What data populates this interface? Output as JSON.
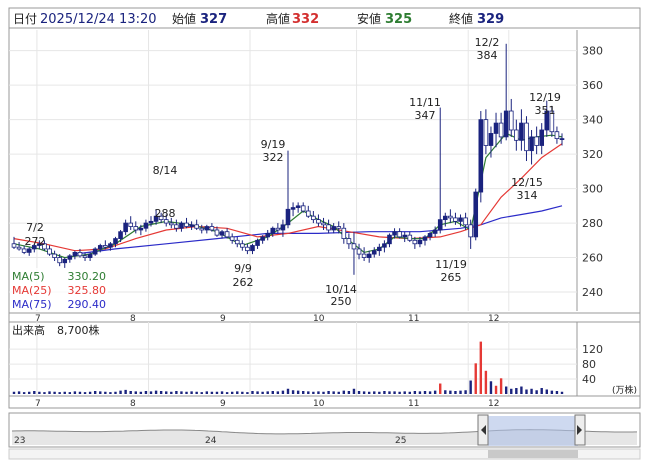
{
  "header": {
    "date_label": "日付",
    "datetime": "2025/12/24 13:20",
    "open_label": "始値",
    "open_value": "327",
    "high_label": "高値",
    "high_value": "332",
    "low_label": "安値",
    "low_value": "325",
    "close_label": "終値",
    "close_value": "329"
  },
  "legend": {
    "ma5": "MA(5)",
    "ma5_value": "330.20",
    "ma25": "MA(25)",
    "ma25_value": "325.80",
    "ma75": "MA(75)",
    "ma75_value": "290.40"
  },
  "volume_panel": {
    "title": "出来高",
    "value": "8,700株",
    "unit": "(万株)"
  },
  "navigator": {
    "date_labels": [
      "23",
      "24",
      "25"
    ]
  },
  "colors": {
    "up": "#1a237e",
    "down": "#ffffff",
    "ma5": "#2e7d32",
    "ma25": "#e53935",
    "ma75": "#2b2bc8",
    "volume": "#1a237e",
    "volume_spike": "#e53935",
    "navigator_fill": "#aebfe6",
    "header_value": "#1a237e",
    "high_value": "#d32f2f",
    "low_value": "#2e7d32"
  },
  "chart_data": {
    "type": "candlestick",
    "frequency": "daily",
    "x_month_labels": [
      "7",
      "8",
      "9",
      "10",
      "11",
      "12"
    ],
    "y_ticks": [
      240,
      260,
      280,
      300,
      320,
      340,
      360,
      380
    ],
    "ylim": [
      229,
      392
    ],
    "volume_ticks": [
      40,
      80,
      120
    ],
    "annotations": [
      {
        "date": "7/2",
        "value": "272",
        "kind": "high"
      },
      {
        "date": "8/14",
        "value": "288",
        "kind": "high"
      },
      {
        "date": "9/19",
        "value": "322",
        "kind": "high"
      },
      {
        "date": "9/9",
        "value": "262",
        "kind": "low"
      },
      {
        "date": "10/14",
        "value": "250",
        "kind": "low"
      },
      {
        "date": "11/11",
        "value": "347",
        "kind": "high"
      },
      {
        "date": "11/19",
        "value": "265",
        "kind": "low"
      },
      {
        "date": "12/2",
        "value": "384",
        "kind": "high"
      },
      {
        "date": "12/19",
        "value": "351",
        "kind": "high"
      },
      {
        "date": "12/15",
        "value": "314",
        "kind": "low"
      }
    ],
    "ohlc": [
      [
        268,
        272,
        265,
        266
      ],
      [
        266,
        269,
        264,
        265
      ],
      [
        265,
        267,
        262,
        263
      ],
      [
        263,
        266,
        261,
        265
      ],
      [
        265,
        268,
        263,
        267
      ],
      [
        267,
        270,
        265,
        268
      ],
      [
        268,
        270,
        264,
        265
      ],
      [
        265,
        267,
        261,
        262
      ],
      [
        262,
        264,
        258,
        260
      ],
      [
        260,
        262,
        255,
        257
      ],
      [
        257,
        260,
        254,
        259
      ],
      [
        259,
        262,
        257,
        261
      ],
      [
        261,
        264,
        259,
        263
      ],
      [
        263,
        265,
        260,
        261
      ],
      [
        261,
        263,
        258,
        260
      ],
      [
        260,
        263,
        258,
        262
      ],
      [
        262,
        266,
        261,
        265
      ],
      [
        265,
        268,
        263,
        267
      ],
      [
        267,
        270,
        265,
        266
      ],
      [
        266,
        269,
        264,
        268
      ],
      [
        268,
        272,
        266,
        271
      ],
      [
        271,
        276,
        269,
        275
      ],
      [
        275,
        282,
        273,
        280
      ],
      [
        280,
        284,
        276,
        278
      ],
      [
        278,
        281,
        274,
        276
      ],
      [
        276,
        279,
        273,
        277
      ],
      [
        277,
        282,
        275,
        280
      ],
      [
        280,
        284,
        278,
        281
      ],
      [
        281,
        288,
        279,
        284
      ],
      [
        284,
        286,
        280,
        282
      ],
      [
        282,
        285,
        278,
        280
      ],
      [
        280,
        283,
        277,
        279
      ],
      [
        279,
        282,
        275,
        277
      ],
      [
        277,
        281,
        275,
        280
      ],
      [
        280,
        283,
        277,
        278
      ],
      [
        278,
        281,
        276,
        279
      ],
      [
        279,
        282,
        276,
        277
      ],
      [
        277,
        279,
        274,
        276
      ],
      [
        276,
        279,
        274,
        278
      ],
      [
        278,
        280,
        275,
        276
      ],
      [
        276,
        278,
        272,
        273
      ],
      [
        273,
        276,
        271,
        275
      ],
      [
        275,
        277,
        271,
        272
      ],
      [
        272,
        274,
        268,
        270
      ],
      [
        270,
        272,
        266,
        268
      ],
      [
        268,
        270,
        264,
        266
      ],
      [
        266,
        268,
        262,
        264
      ],
      [
        264,
        268,
        262,
        267
      ],
      [
        267,
        271,
        265,
        270
      ],
      [
        270,
        273,
        268,
        272
      ],
      [
        272,
        276,
        270,
        274
      ],
      [
        274,
        278,
        272,
        277
      ],
      [
        277,
        280,
        274,
        276
      ],
      [
        276,
        282,
        272,
        279
      ],
      [
        279,
        322,
        277,
        288
      ],
      [
        288,
        292,
        284,
        289
      ],
      [
        289,
        292,
        286,
        290
      ],
      [
        290,
        292,
        286,
        287
      ],
      [
        287,
        290,
        283,
        284
      ],
      [
        284,
        287,
        280,
        282
      ],
      [
        282,
        285,
        278,
        280
      ],
      [
        280,
        283,
        276,
        279
      ],
      [
        279,
        282,
        274,
        276
      ],
      [
        276,
        280,
        274,
        278
      ],
      [
        278,
        281,
        274,
        277
      ],
      [
        277,
        280,
        268,
        271
      ],
      [
        271,
        274,
        265,
        268
      ],
      [
        268,
        275,
        250,
        265
      ],
      [
        265,
        268,
        259,
        262
      ],
      [
        262,
        266,
        258,
        260
      ],
      [
        260,
        264,
        257,
        262
      ],
      [
        262,
        266,
        260,
        264
      ],
      [
        264,
        268,
        261,
        266
      ],
      [
        266,
        270,
        263,
        268
      ],
      [
        268,
        274,
        266,
        273
      ],
      [
        273,
        277,
        271,
        275
      ],
      [
        275,
        277,
        271,
        272
      ],
      [
        272,
        275,
        269,
        273
      ],
      [
        273,
        275,
        269,
        270
      ],
      [
        270,
        272,
        265,
        268
      ],
      [
        268,
        272,
        266,
        270
      ],
      [
        270,
        273,
        267,
        272
      ],
      [
        272,
        275,
        270,
        274
      ],
      [
        274,
        278,
        272,
        276
      ],
      [
        276,
        347,
        274,
        282
      ],
      [
        282,
        286,
        278,
        284
      ],
      [
        284,
        288,
        280,
        283
      ],
      [
        283,
        286,
        279,
        281
      ],
      [
        281,
        285,
        278,
        283
      ],
      [
        283,
        286,
        276,
        279
      ],
      [
        279,
        282,
        265,
        272
      ],
      [
        272,
        300,
        270,
        298
      ],
      [
        298,
        345,
        292,
        340
      ],
      [
        340,
        346,
        320,
        325
      ],
      [
        325,
        336,
        318,
        332
      ],
      [
        332,
        344,
        324,
        338
      ],
      [
        338,
        344,
        326,
        330
      ],
      [
        330,
        384,
        328,
        345
      ],
      [
        345,
        352,
        330,
        334
      ],
      [
        334,
        340,
        322,
        328
      ],
      [
        328,
        346,
        322,
        338
      ],
      [
        338,
        342,
        316,
        322
      ],
      [
        322,
        334,
        314,
        330
      ],
      [
        330,
        336,
        320,
        325
      ],
      [
        325,
        338,
        320,
        334
      ],
      [
        334,
        351,
        330,
        345
      ],
      [
        345,
        348,
        330,
        333
      ],
      [
        333,
        336,
        326,
        329
      ],
      [
        329,
        332,
        325,
        329
      ]
    ],
    "ma5": [
      [
        0,
        268
      ],
      [
        5,
        265
      ],
      [
        10,
        260
      ],
      [
        15,
        262
      ],
      [
        20,
        268
      ],
      [
        25,
        278
      ],
      [
        30,
        281
      ],
      [
        35,
        279
      ],
      [
        40,
        275
      ],
      [
        45,
        267
      ],
      [
        50,
        272
      ],
      [
        54,
        280
      ],
      [
        57,
        287
      ],
      [
        60,
        282
      ],
      [
        63,
        278
      ],
      [
        66,
        270
      ],
      [
        69,
        263
      ],
      [
        72,
        265
      ],
      [
        75,
        272
      ],
      [
        78,
        271
      ],
      [
        81,
        271
      ],
      [
        84,
        279
      ],
      [
        87,
        281
      ],
      [
        90,
        276
      ],
      [
        93,
        318
      ],
      [
        97,
        332
      ],
      [
        100,
        328
      ],
      [
        103,
        330
      ],
      [
        106,
        331
      ],
      [
        108,
        330
      ]
    ],
    "ma25": [
      [
        0,
        271
      ],
      [
        6,
        268
      ],
      [
        12,
        264
      ],
      [
        18,
        265
      ],
      [
        24,
        271
      ],
      [
        30,
        276
      ],
      [
        36,
        278
      ],
      [
        42,
        277
      ],
      [
        48,
        272
      ],
      [
        54,
        274
      ],
      [
        60,
        278
      ],
      [
        66,
        275
      ],
      [
        72,
        272
      ],
      [
        78,
        271
      ],
      [
        84,
        272
      ],
      [
        88,
        275
      ],
      [
        92,
        279
      ],
      [
        96,
        295
      ],
      [
        100,
        306
      ],
      [
        104,
        318
      ],
      [
        108,
        326
      ]
    ],
    "ma75": [
      [
        12,
        262
      ],
      [
        20,
        265
      ],
      [
        30,
        268
      ],
      [
        40,
        271
      ],
      [
        50,
        274
      ],
      [
        60,
        274
      ],
      [
        70,
        275
      ],
      [
        80,
        275
      ],
      [
        88,
        277
      ],
      [
        92,
        279
      ],
      [
        96,
        283
      ],
      [
        100,
        285
      ],
      [
        104,
        287
      ],
      [
        108,
        290
      ]
    ],
    "volume": [
      6,
      7,
      5,
      6,
      8,
      6,
      5,
      7,
      6,
      5,
      6,
      5,
      7,
      6,
      5,
      6,
      8,
      7,
      6,
      5,
      6,
      9,
      11,
      8,
      7,
      6,
      8,
      7,
      9,
      8,
      7,
      6,
      8,
      7,
      6,
      7,
      6,
      5,
      7,
      6,
      6,
      7,
      5,
      6,
      7,
      6,
      5,
      8,
      7,
      6,
      7,
      8,
      7,
      9,
      14,
      10,
      9,
      8,
      7,
      6,
      7,
      6,
      8,
      7,
      6,
      9,
      8,
      14,
      8,
      7,
      6,
      7,
      6,
      8,
      7,
      7,
      6,
      7,
      6,
      8,
      7,
      8,
      7,
      9,
      28,
      10,
      9,
      8,
      9,
      10,
      36,
      82,
      140,
      62,
      34,
      22,
      42,
      20,
      14,
      16,
      20,
      12,
      14,
      10,
      16,
      12,
      9,
      8,
      6
    ],
    "volume_spike_indices": [
      84,
      91,
      92,
      93,
      95,
      96
    ]
  }
}
